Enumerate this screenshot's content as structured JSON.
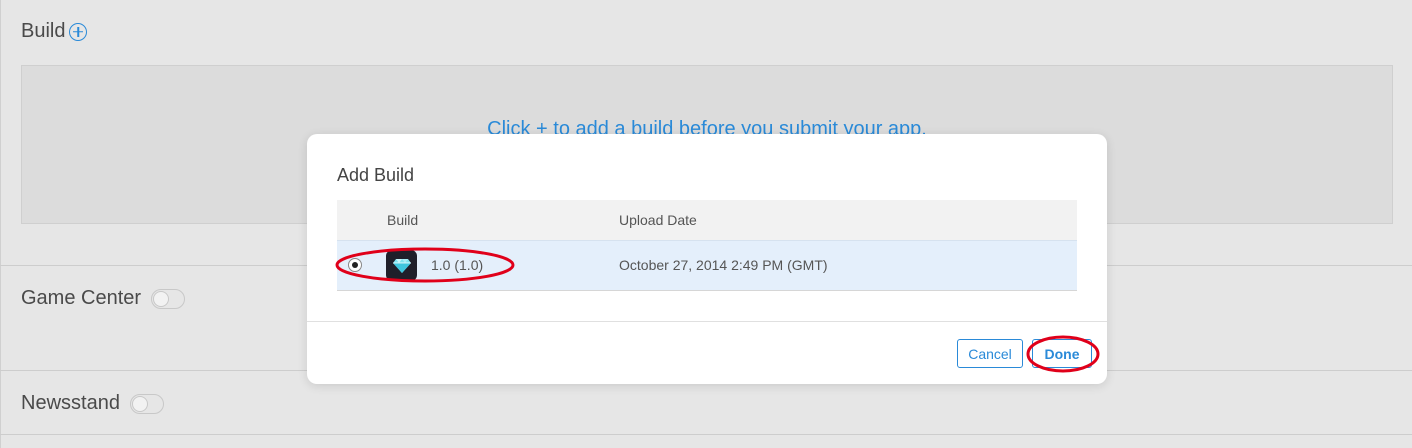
{
  "page": {
    "build_section": {
      "title": "Build",
      "add_icon": "plus-circle-icon",
      "empty_message": "Click + to add a build before you submit your app."
    },
    "game_center": {
      "label": "Game Center",
      "enabled": false
    },
    "newsstand": {
      "label": "Newsstand",
      "enabled": false
    }
  },
  "modal": {
    "title": "Add Build",
    "columns": {
      "build": "Build",
      "upload_date": "Upload Date"
    },
    "rows": [
      {
        "selected": true,
        "icon": "diamond-app-icon",
        "build": "1.0 (1.0)",
        "upload_date": "October 27, 2014 2:49 PM (GMT)"
      }
    ],
    "buttons": {
      "cancel": "Cancel",
      "done": "Done"
    }
  },
  "colors": {
    "accent": "#2a8ad8",
    "selected_row": "#e4effb",
    "annotation": "#e0001a",
    "overlay_background": "#e6e6e6"
  }
}
